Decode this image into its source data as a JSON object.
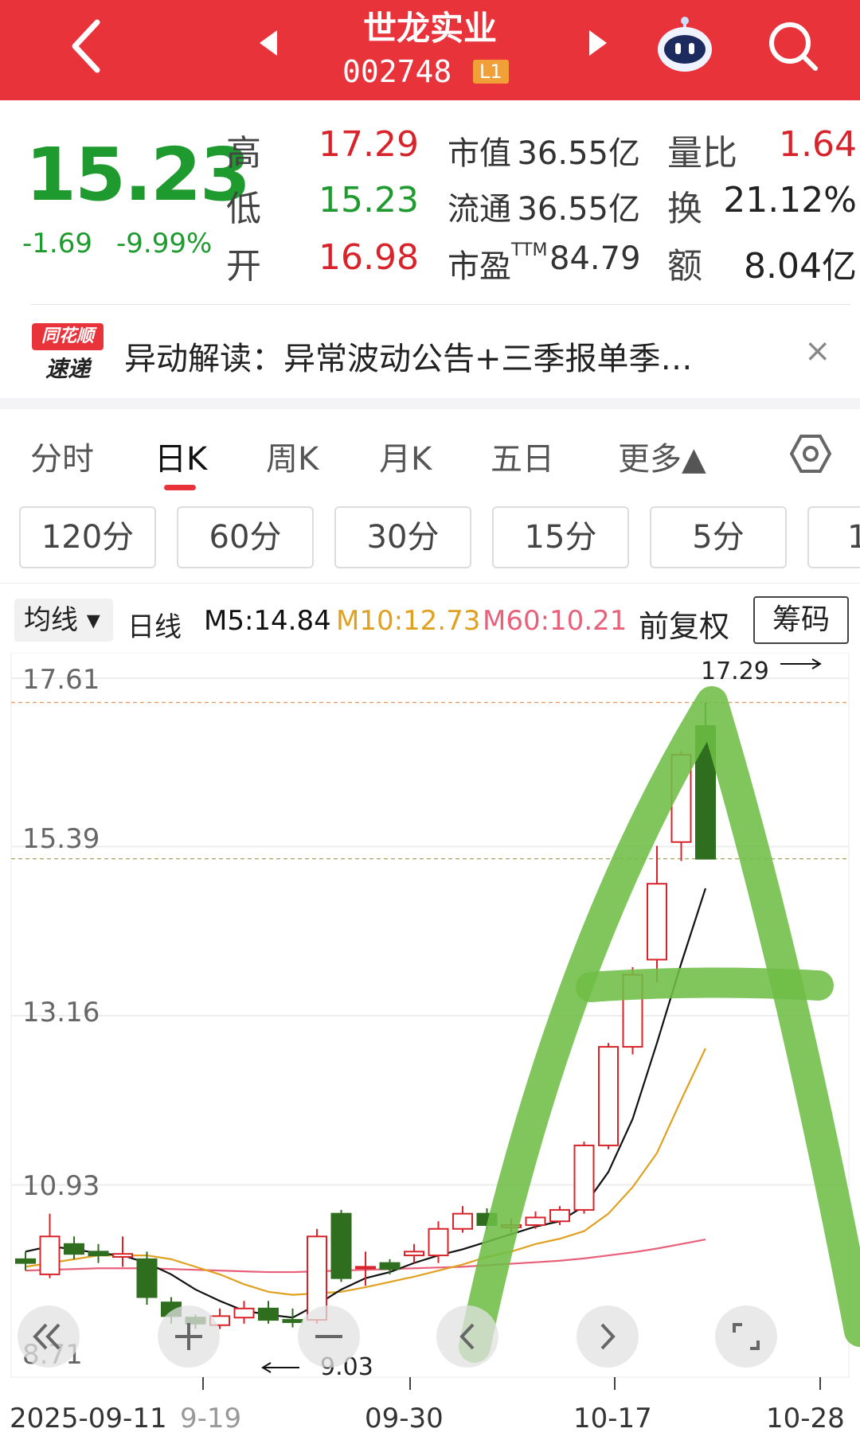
{
  "header": {
    "title": "世龙实业",
    "code": "002748",
    "level_badge": "L1",
    "background": "#e8333b",
    "icons": [
      "back-icon",
      "prev-stock-icon",
      "next-stock-icon",
      "robot-assistant-icon",
      "search-icon"
    ]
  },
  "quote": {
    "price": "15.23",
    "change": "-1.69",
    "change_pct": "-9.99%",
    "high_label": "高",
    "high": "17.29",
    "low_label": "低",
    "low": "15.23",
    "open_label": "开",
    "open": "16.98",
    "mktcap_label": "市值",
    "mktcap": "36.55亿",
    "float_label": "流通",
    "float": "36.55亿",
    "pe_label": "市盈TTM",
    "pe": "84.79",
    "volratio_label": "量比",
    "volratio": "1.64",
    "turnover_label": "换",
    "turnover": "21.12%",
    "amount_label": "额",
    "amount": "8.04亿"
  },
  "news": {
    "logo_top": "同花顺",
    "logo_bottom": "速递",
    "text": "异动解读：异常波动公告+三季报单季…",
    "close": "×"
  },
  "tabs": {
    "items": [
      "分时",
      "日K",
      "周K",
      "月K",
      "五日",
      "更多▲"
    ],
    "active": "日K"
  },
  "periods": [
    "120分",
    "60分",
    "30分",
    "15分",
    "5分",
    "1"
  ],
  "ma_bar": {
    "dropdown": "均线 ▾",
    "line_type": "日线",
    "m5": "M5:14.84",
    "m10": "M10:12.73",
    "m60": "M60:10.21",
    "adjust": "前复权",
    "chip_button": "筹码",
    "m5_color": "#111111",
    "m10_color": "#e0a020",
    "m60_color": "#e8607a"
  },
  "chart_data": {
    "type": "candlestick",
    "y_ticks": [
      "17.61",
      "15.39",
      "13.16",
      "10.93",
      "8.71"
    ],
    "ylim": [
      8.71,
      17.61
    ],
    "x_ticks": [
      "2025-09-11",
      "9-19",
      "09-30",
      "10-17",
      "10-28"
    ],
    "high_annotation": "17.29",
    "low_annotation": "9.03",
    "up_color": "#d8232a",
    "down_color": "#2e6e1e",
    "candles": [
      {
        "o": 9.95,
        "c": 9.9,
        "h": 10.05,
        "l": 9.8
      },
      {
        "o": 9.75,
        "c": 10.25,
        "h": 10.55,
        "l": 9.7
      },
      {
        "o": 10.15,
        "c": 10.02,
        "h": 10.25,
        "l": 9.95
      },
      {
        "o": 10.05,
        "c": 10.0,
        "h": 10.15,
        "l": 9.9
      },
      {
        "o": 9.98,
        "c": 10.02,
        "h": 10.25,
        "l": 9.85
      },
      {
        "o": 9.95,
        "c": 9.45,
        "h": 10.05,
        "l": 9.35
      },
      {
        "o": 9.38,
        "c": 9.2,
        "h": 9.45,
        "l": 9.1
      },
      {
        "o": 9.18,
        "c": 9.1,
        "h": 9.22,
        "l": 9.03
      },
      {
        "o": 9.08,
        "c": 9.2,
        "h": 9.3,
        "l": 9.03
      },
      {
        "o": 9.18,
        "c": 9.3,
        "h": 9.4,
        "l": 9.1
      },
      {
        "o": 9.3,
        "c": 9.15,
        "h": 9.4,
        "l": 9.1
      },
      {
        "o": 9.15,
        "c": 9.12,
        "h": 9.3,
        "l": 9.05
      },
      {
        "o": 9.15,
        "c": 10.25,
        "h": 10.35,
        "l": 9.1
      },
      {
        "o": 10.55,
        "c": 9.7,
        "h": 10.6,
        "l": 9.65
      },
      {
        "o": 9.85,
        "c": 9.85,
        "h": 10.05,
        "l": 9.6
      },
      {
        "o": 9.9,
        "c": 9.82,
        "h": 9.95,
        "l": 9.75
      },
      {
        "o": 10.0,
        "c": 10.05,
        "h": 10.15,
        "l": 9.9
      },
      {
        "o": 10.0,
        "c": 10.35,
        "h": 10.45,
        "l": 9.9
      },
      {
        "o": 10.35,
        "c": 10.55,
        "h": 10.65,
        "l": 10.3
      },
      {
        "o": 10.55,
        "c": 10.4,
        "h": 10.62,
        "l": 10.35
      },
      {
        "o": 10.37,
        "c": 10.4,
        "h": 10.48,
        "l": 10.3
      },
      {
        "o": 10.4,
        "c": 10.5,
        "h": 10.58,
        "l": 10.35
      },
      {
        "o": 10.45,
        "c": 10.6,
        "h": 10.65,
        "l": 10.4
      },
      {
        "o": 10.6,
        "c": 11.45,
        "h": 11.5,
        "l": 10.55
      },
      {
        "o": 11.45,
        "c": 12.75,
        "h": 12.8,
        "l": 11.4
      },
      {
        "o": 12.75,
        "c": 13.7,
        "h": 13.8,
        "l": 12.65
      },
      {
        "o": 13.9,
        "c": 14.9,
        "h": 15.4,
        "l": 13.6
      },
      {
        "o": 15.45,
        "c": 16.6,
        "h": 16.65,
        "l": 15.2
      },
      {
        "o": 16.98,
        "c": 15.23,
        "h": 17.29,
        "l": 15.23
      }
    ],
    "ma5": [
      10.05,
      10.12,
      10.08,
      10.03,
      10.0,
      9.9,
      9.75,
      9.55,
      9.4,
      9.27,
      9.22,
      9.18,
      9.35,
      9.55,
      9.7,
      9.78,
      9.9,
      10.0,
      10.08,
      10.18,
      10.28,
      10.38,
      10.45,
      10.65,
      11.1,
      11.8,
      12.8,
      13.85,
      14.84
    ],
    "ma10": [
      9.85,
      9.9,
      9.95,
      10.0,
      10.0,
      10.0,
      9.95,
      9.85,
      9.75,
      9.62,
      9.52,
      9.48,
      9.5,
      9.52,
      9.58,
      9.65,
      9.72,
      9.8,
      9.88,
      9.98,
      10.05,
      10.15,
      10.22,
      10.32,
      10.55,
      10.9,
      11.35,
      12.05,
      12.73
    ],
    "ma60": [
      9.8,
      9.81,
      9.82,
      9.83,
      9.83,
      9.83,
      9.82,
      9.81,
      9.8,
      9.79,
      9.78,
      9.78,
      9.79,
      9.8,
      9.81,
      9.82,
      9.83,
      9.84,
      9.85,
      9.87,
      9.89,
      9.91,
      9.93,
      9.96,
      10.0,
      10.04,
      10.09,
      10.15,
      10.21
    ]
  }
}
